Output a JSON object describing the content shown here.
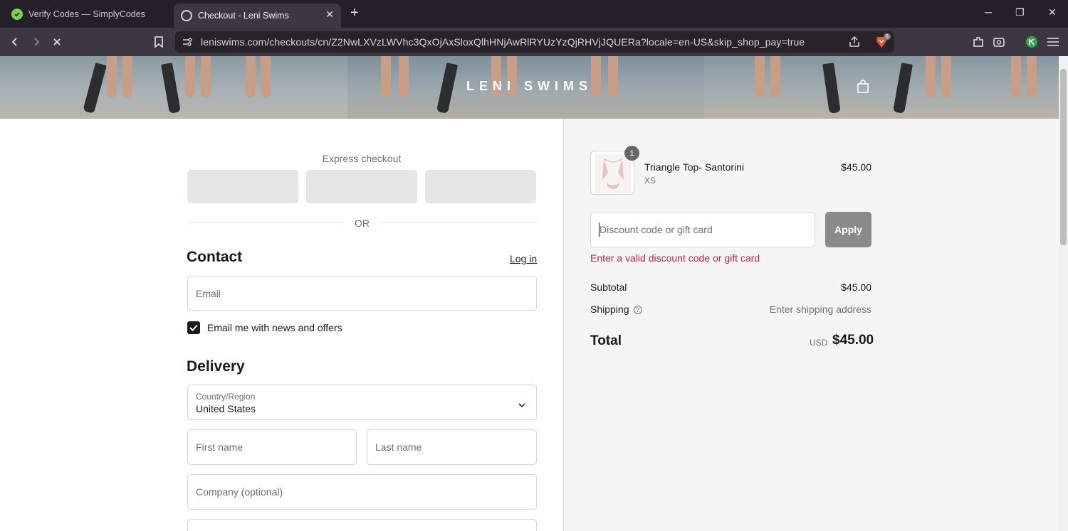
{
  "browser": {
    "tabs": [
      {
        "title": "Verify Codes — SimplyCodes",
        "active": false
      },
      {
        "title": "Checkout - Leni Swims",
        "active": true
      }
    ],
    "url": "leniswims.com/checkouts/cn/Z2NwLXVzLWVhc3QxOjAxSloxQlhHNjAwRlRYUzYzQjRHVjJQUERa?locale=en-US&skip_shop_pay=true",
    "shield_badge": "6"
  },
  "store": {
    "logo": "LENI SWIMS"
  },
  "checkout": {
    "express_title": "Express checkout",
    "or_text": "OR",
    "contact_heading": "Contact",
    "login_link": "Log in",
    "email_placeholder": "Email",
    "news_label": "Email me with news and offers",
    "news_checked": true,
    "delivery_heading": "Delivery",
    "country_label": "Country/Region",
    "country_value": "United States",
    "first_name_placeholder": "First name",
    "last_name_placeholder": "Last name",
    "company_placeholder": "Company (optional)"
  },
  "summary": {
    "item": {
      "qty": "1",
      "name": "Triangle Top- Santorini",
      "variant": "XS",
      "price": "$45.00"
    },
    "discount_placeholder": "Discount code or gift card",
    "apply_label": "Apply",
    "error": "Enter a valid discount code or gift card",
    "subtotal_label": "Subtotal",
    "subtotal_value": "$45.00",
    "shipping_label": "Shipping",
    "shipping_value": "Enter shipping address",
    "total_label": "Total",
    "total_currency": "USD",
    "total_value": "$45.00"
  },
  "colors": {
    "error": "#c4264b",
    "apply_bg": "#8a8a8a",
    "summary_bg": "#f5f5f5"
  }
}
